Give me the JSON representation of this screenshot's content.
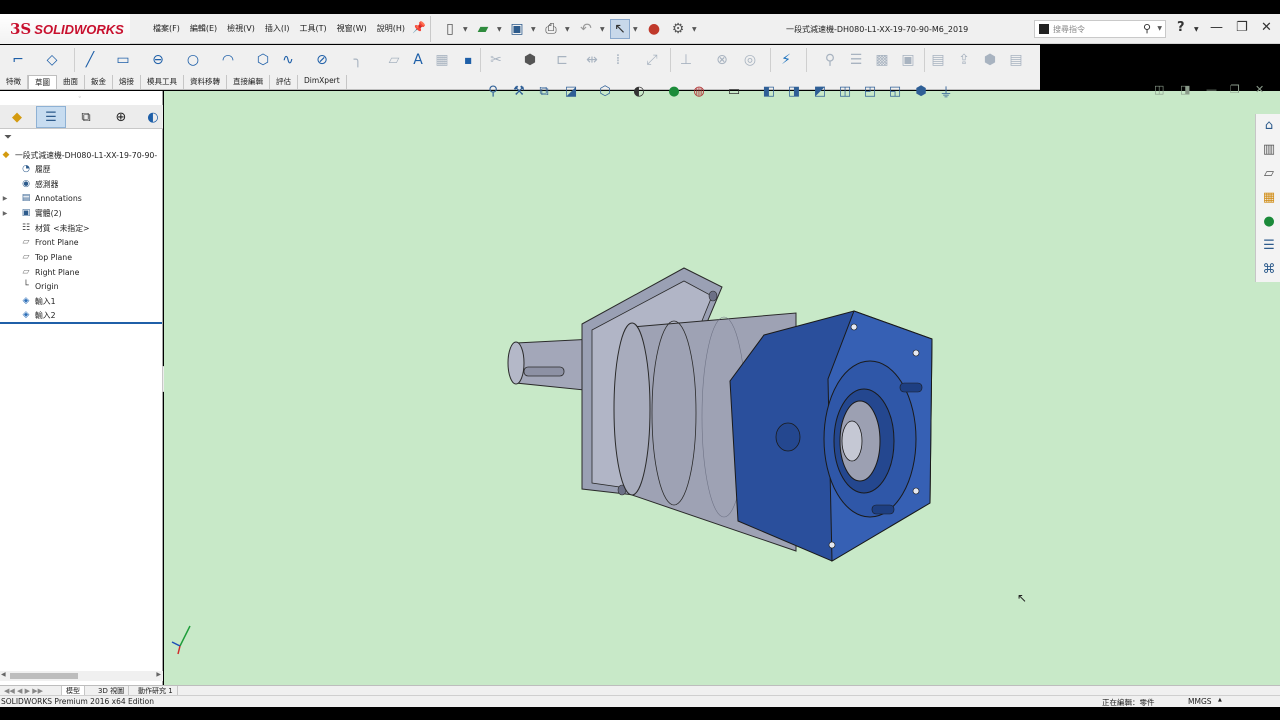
{
  "app": {
    "logo_ds": "3S",
    "logo_name": "SOLIDWORKS"
  },
  "menu": [
    "檔案(F)",
    "編輯(E)",
    "檢視(V)",
    "插入(I)",
    "工具(T)",
    "視窗(W)",
    "說明(H)"
  ],
  "document_title": "一段式減速機-DH080-L1-XX-19-70-90-M6_2019",
  "search": {
    "placeholder": "搜尋指令"
  },
  "command_tabs": [
    {
      "label": "特徵",
      "active": false
    },
    {
      "label": "草圖",
      "active": true
    },
    {
      "label": "曲面",
      "active": false
    },
    {
      "label": "鈑金",
      "active": false
    },
    {
      "label": "熔接",
      "active": false
    },
    {
      "label": "模具工具",
      "active": false
    },
    {
      "label": "資料移轉",
      "active": false
    },
    {
      "label": "直接編輯",
      "active": false
    },
    {
      "label": "評估",
      "active": false
    },
    {
      "label": "DimXpert",
      "active": false
    }
  ],
  "tree": {
    "root": "一段式減速機-DH080-L1-XX-19-70-90-",
    "items": [
      {
        "label": "履歷",
        "icon": "history-icon",
        "expandable": false
      },
      {
        "label": "感測器",
        "icon": "sensor-icon",
        "expandable": false
      },
      {
        "label": "Annotations",
        "icon": "annotations-icon",
        "expandable": true
      },
      {
        "label": "實體(2)",
        "icon": "solid-bodies-icon",
        "expandable": true
      },
      {
        "label": "材質 <未指定>",
        "icon": "material-icon",
        "expandable": false
      },
      {
        "label": "Front Plane",
        "icon": "plane-icon",
        "expandable": false
      },
      {
        "label": "Top Plane",
        "icon": "plane-icon",
        "expandable": false
      },
      {
        "label": "Right Plane",
        "icon": "plane-icon",
        "expandable": false
      },
      {
        "label": "Origin",
        "icon": "origin-icon",
        "expandable": false
      },
      {
        "label": "輸入1",
        "icon": "imported-body-icon",
        "expandable": false
      },
      {
        "label": "輸入2",
        "icon": "imported-body-icon",
        "expandable": false
      }
    ]
  },
  "bottom_tabs": [
    {
      "label": "模型",
      "active": true
    },
    {
      "label": "3D 視圖",
      "active": false
    },
    {
      "label": "動作研究 1",
      "active": false
    }
  ],
  "status": {
    "edition": "SOLIDWORKS Premium 2016 x64 Edition",
    "mode": "正在編輯：零件",
    "units": "MMGS"
  },
  "colors": {
    "viewport_bg": "#c8e9c8",
    "gearbox_body": "#9ea2b4",
    "flange_blue": "#2f56a8",
    "brand_red": "#c8102e"
  }
}
